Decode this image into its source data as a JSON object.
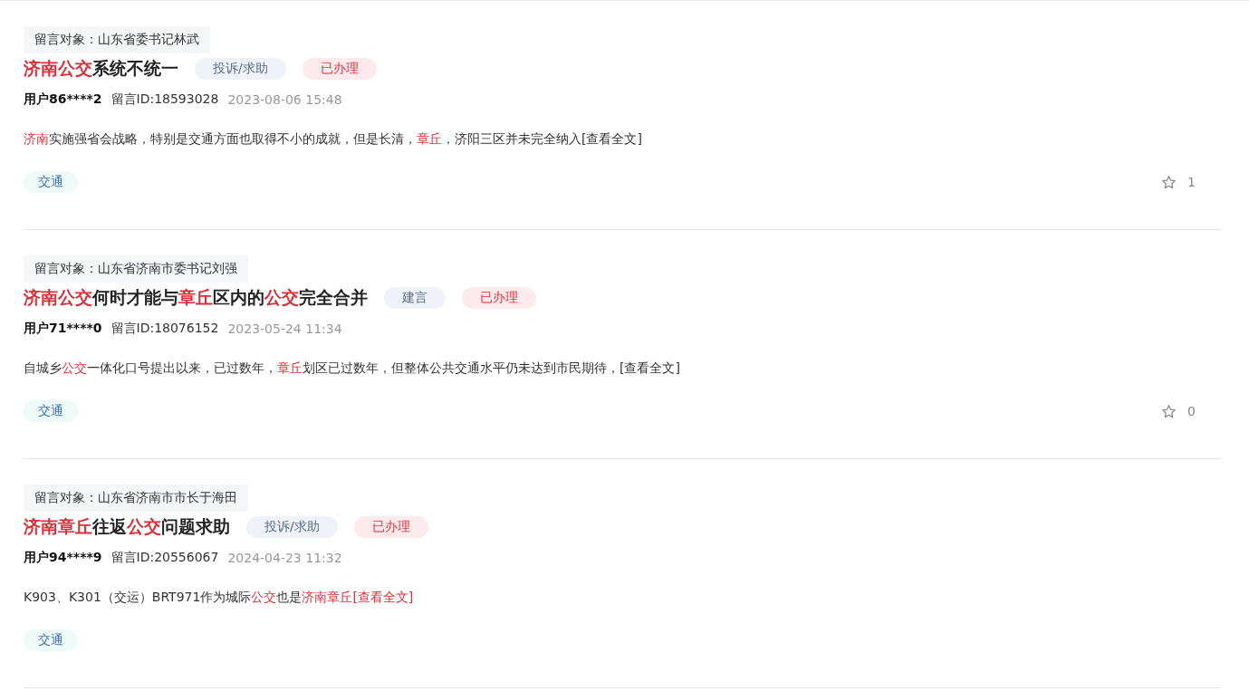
{
  "posts": [
    {
      "target": "留言对象：山东省委书记林武",
      "title": [
        {
          "text": "济南公交",
          "highlight": true
        },
        {
          "text": "系统不统一",
          "highlight": false
        }
      ],
      "category": "投诉/求助",
      "status": "已办理",
      "user": "用户86****2",
      "message_id": "留言ID:18593028",
      "time": "2023-08-06 15:48",
      "excerpt": [
        {
          "text": "济南",
          "highlight": true
        },
        {
          "text": "实施强省会战略，特别是交通方面也取得不小的成就，但是长清，",
          "highlight": false
        },
        {
          "text": "章丘",
          "highlight": true
        },
        {
          "text": "，济阳三区并未完全纳入",
          "highlight": false
        }
      ],
      "more": {
        "text": "[查看全文]",
        "highlight": false
      },
      "tag": "交通",
      "likes": "1"
    },
    {
      "target": "留言对象：山东省济南市委书记刘强",
      "title": [
        {
          "text": "济南公交",
          "highlight": true
        },
        {
          "text": "何时才能与",
          "highlight": false
        },
        {
          "text": "章丘",
          "highlight": true
        },
        {
          "text": "区内的",
          "highlight": false
        },
        {
          "text": "公交",
          "highlight": true
        },
        {
          "text": "完全合并",
          "highlight": false
        }
      ],
      "category": "建言",
      "status": "已办理",
      "user": "用户71****0",
      "message_id": "留言ID:18076152",
      "time": "2023-05-24 11:34",
      "excerpt": [
        {
          "text": "自城乡",
          "highlight": false
        },
        {
          "text": "公交",
          "highlight": true
        },
        {
          "text": "一体化口号提出以来，已过数年，",
          "highlight": false
        },
        {
          "text": "章丘",
          "highlight": true
        },
        {
          "text": "划区已过数年，但整体公共交通水平仍未达到市民期待，",
          "highlight": false
        }
      ],
      "more": {
        "text": "[查看全文]",
        "highlight": false
      },
      "tag": "交通",
      "likes": "0"
    },
    {
      "target": "留言对象：山东省济南市市长于海田",
      "title": [
        {
          "text": "济南章丘",
          "highlight": true
        },
        {
          "text": "往返",
          "highlight": false
        },
        {
          "text": "公交",
          "highlight": true
        },
        {
          "text": "问题求助",
          "highlight": false
        }
      ],
      "category": "投诉/求助",
      "status": "已办理",
      "user": "用户94****9",
      "message_id": "留言ID:20556067",
      "time": "2024-04-23 11:32",
      "excerpt": [
        {
          "text": "K903、K301（交运）BRT971作为城际",
          "highlight": false
        },
        {
          "text": "公交",
          "highlight": true
        },
        {
          "text": "也是",
          "highlight": false
        },
        {
          "text": "济南章丘",
          "highlight": true
        }
      ],
      "more": {
        "text": "[查看全文]",
        "highlight": true
      },
      "tag": "交通"
    }
  ]
}
